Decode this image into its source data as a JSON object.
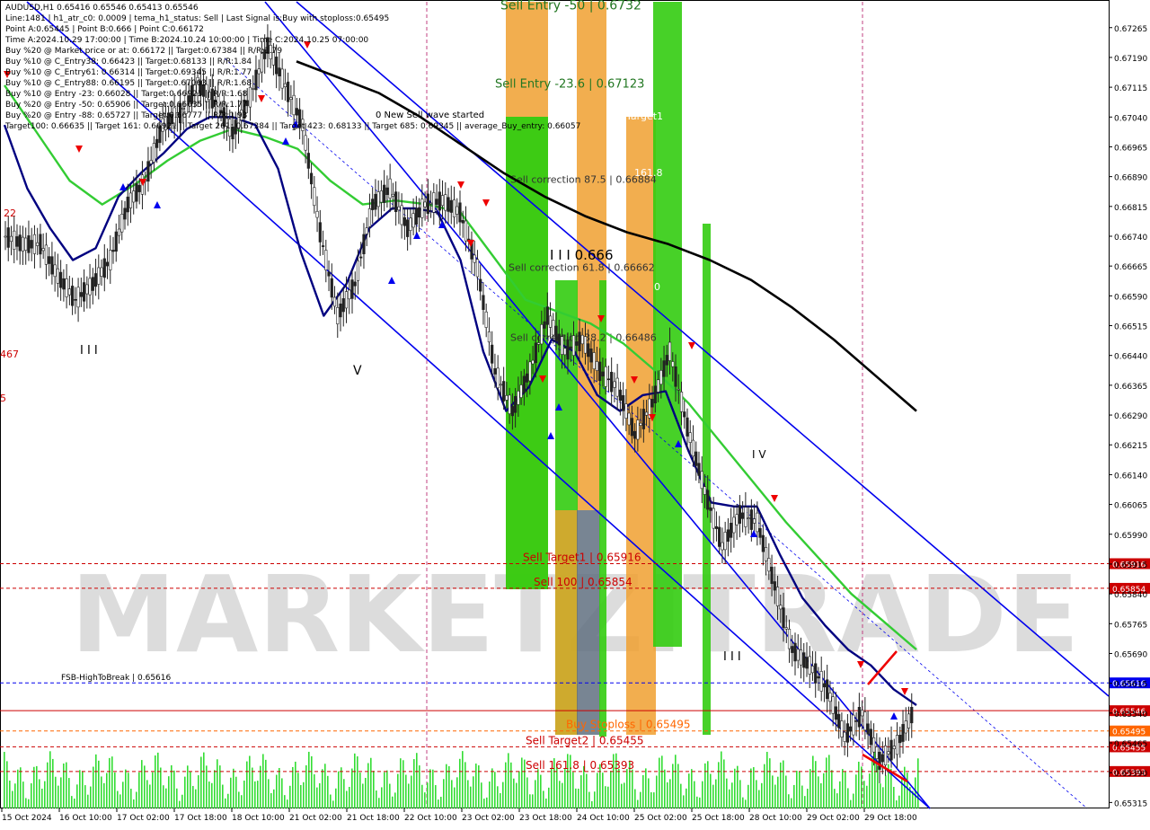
{
  "header": {
    "symbol_line": "AUDUSD,H1  0.65416 0.65546 0.65413 0.65546",
    "info_lines": [
      "Line:1481 | h1_atr_c0: 0.0009 | tema_h1_status: Sell | Last Signal is:Buy with stoploss:0.65495",
      "Point A:0.65445 | Point B:0.666 | Point C:0.66172",
      "Time A:2024.10.29 17:00:00 | Time B:2024.10.24 10:00:00 | Time C:2024.10.25 07:00:00",
      "Buy %20 @ Market price or at: 0.66172 || Target:0.67384 || R/R:1.79",
      "Buy %10 @ C_Entry38: 0.66423 || Target:0.68133 || R/R:1.84",
      "Buy %10 @ C_Entry61: 0.66314 || Target:0.69345 || R/R:1.77",
      "Buy %10 @ C_Entry88: 0.66195 || Target:0.67063 || R/R:1.68",
      "Buy %10 @ Entry -23: 0.66028 || Target:0.66921 || R/R:1.68",
      "Buy %20 @ Entry -50: 0.65906 || Target:0.66635 || R/R:1.77",
      "Buy %20 @ Entry -88: 0.65727 || Target:0.66777 || R/R:1.93",
      "Target100: 0.66635 || Target 161: 0.66921 || Target 261: 0.67384 || Target 423: 0.68133 || Target 685: 0.69345 || average_Buy_entry: 0.66057"
    ]
  },
  "chart_data": {
    "type": "line",
    "title": "AUDUSD,H1",
    "x_tick_labels": [
      "15 Oct 2024",
      "16 Oct 10:00",
      "17 Oct 02:00",
      "17 Oct 18:00",
      "18 Oct 10:00",
      "21 Oct 02:00",
      "21 Oct 18:00",
      "22 Oct 10:00",
      "23 Oct 02:00",
      "23 Oct 18:00",
      "24 Oct 10:00",
      "25 Oct 02:00",
      "25 Oct 18:00",
      "28 Oct 10:00",
      "29 Oct 02:00",
      "29 Oct 18:00"
    ],
    "y_tick_labels": [
      "0.67265",
      "0.67190",
      "0.67115",
      "0.67040",
      "0.66965",
      "0.66890",
      "0.66815",
      "0.66740",
      "0.66665",
      "0.66590",
      "0.66515",
      "0.66440",
      "0.66365",
      "0.66290",
      "0.66215",
      "0.66140",
      "0.66065",
      "0.65990",
      "0.65915",
      "0.65840",
      "0.65765",
      "0.65690",
      "0.65615",
      "0.65540",
      "0.65465",
      "0.65390",
      "0.65315"
    ],
    "ylim": [
      0.653,
      0.6733
    ],
    "series": [
      {
        "name": "",
        "color": "#000000",
        "values": [
          0.6674,
          0.6672,
          0.6672,
          0.6664,
          0.6658,
          0.6662,
          0.6668,
          0.6682,
          0.6688,
          0.6702,
          0.6705,
          0.6712,
          0.6708,
          0.67,
          0.6709,
          0.6722,
          0.6712,
          0.6702,
          0.6675,
          0.6654,
          0.6662,
          0.6682,
          0.6686,
          0.6676,
          0.6682,
          0.6683,
          0.668,
          0.6666,
          0.664,
          0.663,
          0.664,
          0.6654,
          0.6645,
          0.6648,
          0.664,
          0.6636,
          0.6624,
          0.6632,
          0.6645,
          0.6626,
          0.661,
          0.6596,
          0.6604,
          0.6602,
          0.6586,
          0.657,
          0.6566,
          0.656,
          0.6548,
          0.6554,
          0.6542,
          0.6546,
          0.6555
        ]
      }
    ],
    "indicators": {
      "ma_fast": [
        0.6702,
        0.6686,
        0.6676,
        0.6668,
        0.6671,
        0.6684,
        0.669,
        0.6695,
        0.6701,
        0.6704,
        0.6704,
        0.6702,
        0.6691,
        0.667,
        0.6654,
        0.6662,
        0.6676,
        0.6681,
        0.6681,
        0.668,
        0.6668,
        0.6645,
        0.663,
        0.6636,
        0.6648,
        0.6645,
        0.6634,
        0.663,
        0.6634,
        0.6635,
        0.662,
        0.6607,
        0.6606,
        0.6606,
        0.6594,
        0.6583,
        0.6576,
        0.657,
        0.6566,
        0.656,
        0.6556
      ],
      "ma_mid": [
        0.6712,
        0.67,
        0.6688,
        0.6682,
        0.6687,
        0.6693,
        0.6698,
        0.6701,
        0.6699,
        0.6696,
        0.6688,
        0.6682,
        0.6683,
        0.6682,
        0.668,
        0.6669,
        0.6658,
        0.6655,
        0.6652,
        0.6647,
        0.664,
        0.6632,
        0.6622,
        0.6612,
        0.6602,
        0.6593,
        0.6584,
        0.6577,
        0.657
      ],
      "ma_slow": [
        0.6718,
        0.6714,
        0.671,
        0.6704,
        0.6697,
        0.669,
        0.6684,
        0.6679,
        0.6675,
        0.6672,
        0.6668,
        0.6663,
        0.6656,
        0.6648,
        0.6639,
        0.663
      ]
    },
    "levels": [
      {
        "label": "Sell Target1 | 0.65916",
        "value": 0.65916,
        "color": "#cc0000",
        "badge": "0.65916"
      },
      {
        "label": "Sell 100 | 0.65854",
        "value": 0.65854,
        "color": "#cc0000",
        "badge": "0.65854"
      },
      {
        "label": "FSB-HighToBreak | 0.65616",
        "value": 0.65616,
        "color": "#0000ee",
        "badge": "0.65616"
      },
      {
        "label": "",
        "value": 0.65546,
        "color": "#cc0000",
        "badge": "0.65546"
      },
      {
        "label": "Buy Stoploss | 0.65495",
        "value": 0.65495,
        "color": "#ff6600",
        "badge": "0.65495"
      },
      {
        "label": "Sell Target2 | 0.65455",
        "value": 0.65455,
        "color": "#cc0000",
        "badge": "0.65455"
      },
      {
        "label": "Sell 161.8 | 0.65393",
        "value": 0.65393,
        "color": "#cc0000",
        "badge": "0.65393"
      }
    ],
    "zone_labels": [
      {
        "text": "Sell Entry -50 | 0.6732",
        "value": 0.6732
      },
      {
        "text": "Sell Entry -23.6 | 0.67123",
        "value": 0.67123
      },
      {
        "text": "Sell correction 87.5 | 0.66884",
        "value": 0.66884
      },
      {
        "text": "Sell correction 61.8 | 0.66662",
        "value": 0.66662
      },
      {
        "text": "Sell correction 38.2 | 0.66486",
        "value": 0.66486
      }
    ],
    "annotations": [
      "0 New Sell wave started",
      "I I I 0.666",
      "Target1",
      "161.8",
      "0",
      "I V",
      "V",
      "I I I",
      "I I I",
      "22",
      "467",
      "5"
    ],
    "watermark": "MARKETZITRADE",
    "grid": false,
    "legend": "none"
  },
  "colors": {
    "bull_candle": "#222222",
    "bear_candle": "#222222",
    "channel": "#0000ee",
    "ma_fast": "#000080",
    "ma_mid": "#33cc33",
    "ma_slow": "#000000",
    "zone_orange": "#f0a030",
    "zone_green": "#33cc11",
    "volume": "#33dd33",
    "sell_arrow": "#ee0000",
    "buy_arrow": "#0000ee"
  }
}
